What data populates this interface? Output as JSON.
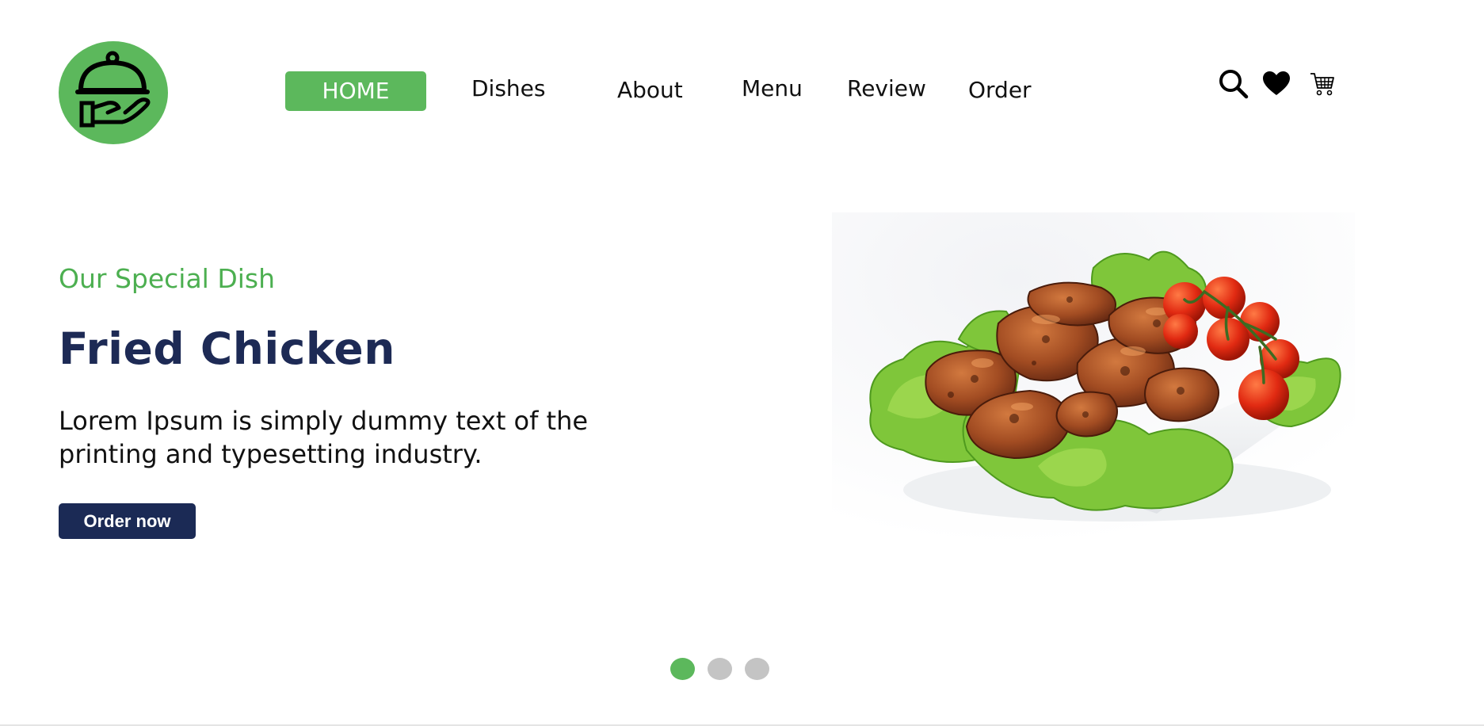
{
  "logo": {
    "icon": "cloche-on-hand-icon",
    "color": "#5cb85c"
  },
  "nav": {
    "items": [
      {
        "label": "HOME",
        "active": true
      },
      {
        "label": "Dishes",
        "active": false
      },
      {
        "label": "About",
        "active": false
      },
      {
        "label": "Menu",
        "active": false
      },
      {
        "label": "Review",
        "active": false
      },
      {
        "label": "Order",
        "active": false
      }
    ],
    "active_color": "#5cb85c"
  },
  "header_icons": [
    "search-icon",
    "heart-icon",
    "cart-icon"
  ],
  "hero": {
    "eyebrow": "Our Special Dish",
    "title": "Fried Chicken",
    "description": "Lorem Ipsum is simply dummy text of the printing and typesetting industry.",
    "button_label": "Order now",
    "image": "fried-chicken-plate",
    "title_color": "#1d2a55",
    "eyebrow_color": "#4caf50"
  },
  "carousel": {
    "dots": 3,
    "active_index": 0,
    "active_color": "#5cb85c",
    "inactive_color": "#c4c4c4"
  }
}
